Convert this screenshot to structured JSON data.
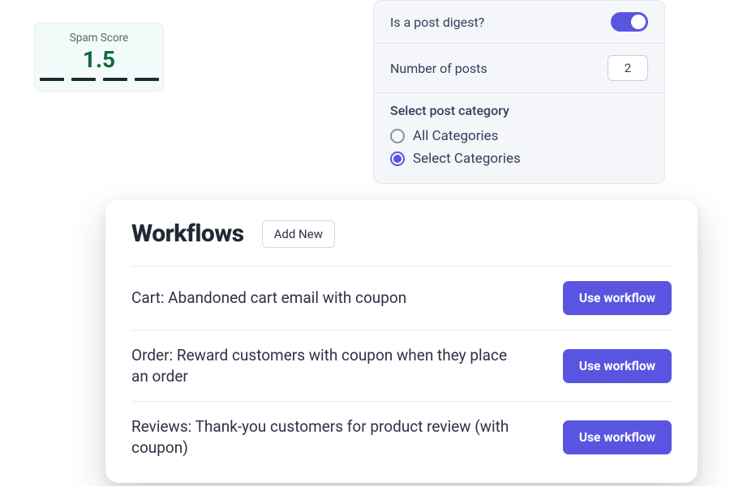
{
  "spam": {
    "label": "Spam Score",
    "value": "1.5"
  },
  "settings": {
    "digest_label": "Is a post digest?",
    "digest_on": true,
    "posts_label": "Number of posts",
    "posts_value": "2",
    "category_heading": "Select post category",
    "options": [
      {
        "label": "All Categories",
        "selected": false
      },
      {
        "label": "Select Categories",
        "selected": true
      }
    ]
  },
  "workflows": {
    "title": "Workflows",
    "add_label": "Add New",
    "use_label": "Use workflow",
    "items": [
      {
        "text": "Cart: Abandoned cart email with coupon"
      },
      {
        "text": "Order: Reward customers with coupon when they place an order"
      },
      {
        "text": "Reviews: Thank-you customers for product review (with coupon)"
      }
    ]
  }
}
